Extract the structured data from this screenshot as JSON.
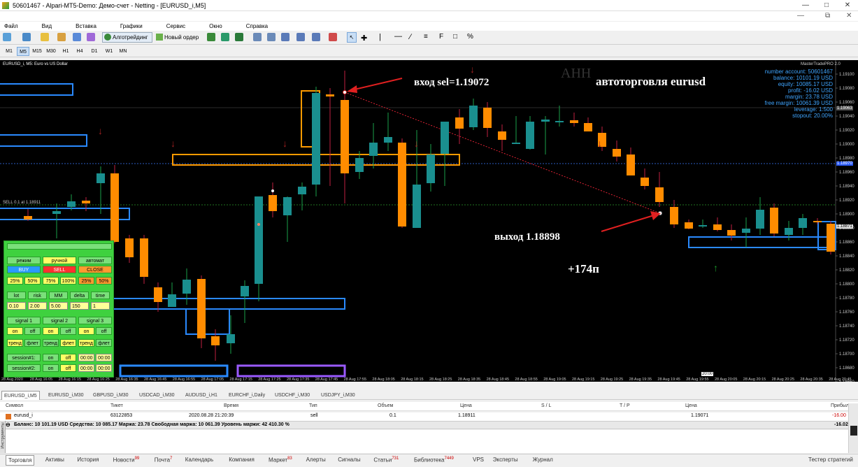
{
  "window": {
    "title": "50601467 - Alpari-MT5-Demo: Демо-счет - Netting - [EURUSD_i,M5]"
  },
  "menu": [
    "Файл",
    "Вид",
    "Вставка",
    "Графики",
    "Сервис",
    "Окно",
    "Справка"
  ],
  "toolbar": {
    "algo_label": "Алготрейдинг",
    "new_order_label": "Новый ордер"
  },
  "timeframes": [
    "M1",
    "M5",
    "M15",
    "M30",
    "H1",
    "H4",
    "D1",
    "W1",
    "MN"
  ],
  "active_timeframe": "M5",
  "chart": {
    "symbol_label": "EURUSD_i, M5:  Euro vs US Dollar",
    "sell_label": "SELL 0.1 at 1.18911",
    "annotation_entry": "вход sel=1.19072",
    "annotation_exit": "выход 1.18898",
    "annotation_profit": "+174п",
    "annotation_title": "автоторговля eurusd",
    "annotation_faded": "АНН",
    "indicator_name": "MasterTradePRO 2.0",
    "time_marker": "20:00",
    "price_ticks": [
      "1.19100",
      "1.19080",
      "1.19060",
      "1.19040",
      "1.19020",
      "1.19000",
      "1.18980",
      "1.18960",
      "1.18940",
      "1.18920",
      "1.18900",
      "1.18880",
      "1.18860",
      "1.18840",
      "1.18820",
      "1.18800",
      "1.18780",
      "1.18760",
      "1.18740",
      "1.18720",
      "1.18700",
      "1.18680",
      "1.18660"
    ],
    "time_ticks": [
      "28 Aug 2020",
      "28 Aug 16:05",
      "28 Aug 16:15",
      "28 Aug 16:25",
      "28 Aug 16:35",
      "28 Aug 16:45",
      "28 Aug 16:55",
      "28 Aug 17:05",
      "28 Aug 17:15",
      "28 Aug 17:25",
      "28 Aug 17:35",
      "28 Aug 17:45",
      "28 Aug 17:55",
      "28 Aug 18:05",
      "28 Aug 18:15",
      "28 Aug 18:25",
      "28 Aug 18:35",
      "28 Aug 18:45",
      "28 Aug 18:55",
      "28 Aug 19:05",
      "28 Aug 19:15",
      "28 Aug 19:25",
      "28 Aug 19:35",
      "28 Aug 19:45",
      "28 Aug 19:55",
      "28 Aug 20:05",
      "28 Aug 20:15",
      "28 Aug 20:25",
      "28 Aug 20:35",
      "28 Aug 20:45"
    ],
    "price_badge_top": "1.19063",
    "price_badge_mid": "1.18970",
    "price_badge_bottom": "1.18871"
  },
  "account_info": [
    "number account: 50601467",
    "balance: 10101.19 USD",
    "equity: 10085.17 USD",
    "profit: -16.02 USD",
    "margin: 23.78 USD",
    "free margin: 10061.39 USD",
    "leverage: 1:500",
    "stopout: 20.00%"
  ],
  "panel": {
    "row1": [
      "режим",
      "ручной",
      "автомат"
    ],
    "row2": [
      "BUY",
      "SELL",
      "CLOSE"
    ],
    "row3": [
      "25%",
      "50%",
      "75%",
      "100%",
      "25%",
      "50%"
    ],
    "row4": [
      "lot",
      "risk",
      "MM",
      "delta",
      "time"
    ],
    "row5": [
      "0.10",
      "2.00",
      "5.00",
      "150",
      "1"
    ],
    "row6": [
      "signal 1",
      "signal 2",
      "signal 3"
    ],
    "row7": [
      "on",
      "off",
      "on",
      "off",
      "on",
      "off"
    ],
    "row8": [
      "тренд",
      "флет",
      "тренд",
      "флет",
      "тренд",
      "флет"
    ],
    "row9": [
      "session#1:",
      "on",
      "off",
      "00:00",
      "00:00"
    ],
    "row10": [
      "session#2:",
      "on",
      "off",
      "00:00",
      "00:00"
    ]
  },
  "chart_tabs": [
    "EURUSD_i,M5",
    "EURUSD_i,M30",
    "GBPUSD_i,M30",
    "USDCAD_i,M30",
    "AUDUSD_i,H1",
    "EURCHF_i,Daily",
    "USDCHF_i,M30",
    "USDJPY_i,M30"
  ],
  "trade_table": {
    "headers": [
      "Символ",
      "Тикет",
      "Время",
      "Тип",
      "Объем",
      "Цена",
      "S / L",
      "T / P",
      "Цена",
      "Прибыль"
    ],
    "row": [
      "eurusd_i",
      "63122853",
      "2020.08.28 21:20:39",
      "sell",
      "0.1",
      "1.18911",
      "",
      "",
      "1.19071",
      "-16.00"
    ],
    "balance_line": "Баланс: 10 101.19 USD  Средства: 10 085.17  Маржа: 23.78  Свободная маржа: 10 061.39  Уровень маржи: 42 410.30 %",
    "balance_profit": "-16.02"
  },
  "bottom_tabs": [
    {
      "label": "Торговля"
    },
    {
      "label": "Активы"
    },
    {
      "label": "История"
    },
    {
      "label": "Новости",
      "badge": "99"
    },
    {
      "label": "Почта",
      "badge": "7"
    },
    {
      "label": "Календарь"
    },
    {
      "label": "Компания"
    },
    {
      "label": "Маркет",
      "badge": "83"
    },
    {
      "label": "Алерты"
    },
    {
      "label": "Сигналы"
    },
    {
      "label": "Статьи",
      "badge": "731"
    },
    {
      "label": "Библиотека",
      "badge": "7449"
    },
    {
      "label": "VPS"
    },
    {
      "label": "Эксперты"
    },
    {
      "label": "Журнал"
    }
  ],
  "strategy_tester": "Тестер стратегий",
  "sidebar_label": "Инструменты",
  "colors": {
    "bull": "#1a8f8f",
    "bear": "#ff8c00",
    "panel": "#3fd13f",
    "info": "#3fa5ff"
  }
}
